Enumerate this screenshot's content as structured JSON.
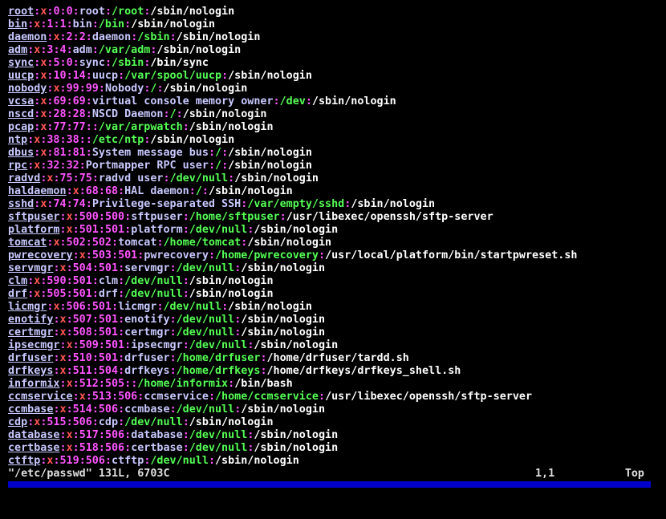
{
  "editor": {
    "lines": [
      {
        "user": "root",
        "pw": "x",
        "uid": "0",
        "gid": "0",
        "gecos": "root",
        "home": "/root",
        "shell": "/sbin/nologin"
      },
      {
        "user": "bin",
        "pw": "x",
        "uid": "1",
        "gid": "1",
        "gecos": "bin",
        "home": "/bin",
        "shell": "/sbin/nologin"
      },
      {
        "user": "daemon",
        "pw": "x",
        "uid": "2",
        "gid": "2",
        "gecos": "daemon",
        "home": "/sbin",
        "shell": "/sbin/nologin"
      },
      {
        "user": "adm",
        "pw": "x",
        "uid": "3",
        "gid": "4",
        "gecos": "adm",
        "home": "/var/adm",
        "shell": "/sbin/nologin"
      },
      {
        "user": "sync",
        "pw": "x",
        "uid": "5",
        "gid": "0",
        "gecos": "sync",
        "home": "/sbin",
        "shell": "/bin/sync"
      },
      {
        "user": "uucp",
        "pw": "x",
        "uid": "10",
        "gid": "14",
        "gecos": "uucp",
        "home": "/var/spool/uucp",
        "shell": "/sbin/nologin"
      },
      {
        "user": "nobody",
        "pw": "x",
        "uid": "99",
        "gid": "99",
        "gecos": "Nobody",
        "home": "/",
        "shell": "/sbin/nologin"
      },
      {
        "user": "vcsa",
        "pw": "x",
        "uid": "69",
        "gid": "69",
        "gecos": "virtual console memory owner",
        "home": "/dev",
        "shell": "/sbin/nologin"
      },
      {
        "user": "nscd",
        "pw": "x",
        "uid": "28",
        "gid": "28",
        "gecos": "NSCD Daemon",
        "home": "/",
        "shell": "/sbin/nologin"
      },
      {
        "user": "pcap",
        "pw": "x",
        "uid": "77",
        "gid": "77",
        "gecos": "",
        "home": "/var/arpwatch",
        "shell": "/sbin/nologin"
      },
      {
        "user": "ntp",
        "pw": "x",
        "uid": "38",
        "gid": "38",
        "gecos": "",
        "home": "/etc/ntp",
        "shell": "/sbin/nologin"
      },
      {
        "user": "dbus",
        "pw": "x",
        "uid": "81",
        "gid": "81",
        "gecos": "System message bus",
        "home": "/",
        "shell": "/sbin/nologin"
      },
      {
        "user": "rpc",
        "pw": "x",
        "uid": "32",
        "gid": "32",
        "gecos": "Portmapper RPC user",
        "home": "/",
        "shell": "/sbin/nologin"
      },
      {
        "user": "radvd",
        "pw": "x",
        "uid": "75",
        "gid": "75",
        "gecos": "radvd user",
        "home": "/dev/null",
        "shell": "/sbin/nologin"
      },
      {
        "user": "haldaemon",
        "pw": "x",
        "uid": "68",
        "gid": "68",
        "gecos": "HAL daemon",
        "home": "/",
        "shell": "/sbin/nologin"
      },
      {
        "user": "sshd",
        "pw": "x",
        "uid": "74",
        "gid": "74",
        "gecos": "Privilege-separated SSH",
        "home": "/var/empty/sshd",
        "shell": "/sbin/nologin"
      },
      {
        "user": "sftpuser",
        "pw": "x",
        "uid": "500",
        "gid": "500",
        "gecos": "sftpuser",
        "home": "/home/sftpuser",
        "shell": "/usr/libexec/openssh/sftp-server"
      },
      {
        "user": "platform",
        "pw": "x",
        "uid": "501",
        "gid": "501",
        "gecos": "platform",
        "home": "/dev/null",
        "shell": "/sbin/nologin"
      },
      {
        "user": "tomcat",
        "pw": "x",
        "uid": "502",
        "gid": "502",
        "gecos": "tomcat",
        "home": "/home/tomcat",
        "shell": "/sbin/nologin"
      },
      {
        "user": "pwrecovery",
        "pw": "x",
        "uid": "503",
        "gid": "501",
        "gecos": "pwrecovery",
        "home": "/home/pwrecovery",
        "shell": "/usr/local/platform/bin/startpwreset.sh"
      },
      {
        "user": "servmgr",
        "pw": "x",
        "uid": "504",
        "gid": "501",
        "gecos": "servmgr",
        "home": "/dev/null",
        "shell": "/sbin/nologin"
      },
      {
        "user": "clm",
        "pw": "x",
        "uid": "590",
        "gid": "501",
        "gecos": "clm",
        "home": "/dev/null",
        "shell": "/sbin/nologin"
      },
      {
        "user": "drf",
        "pw": "x",
        "uid": "505",
        "gid": "501",
        "gecos": "drf",
        "home": "/dev/null",
        "shell": "/sbin/nologin"
      },
      {
        "user": "licmgr",
        "pw": "x",
        "uid": "506",
        "gid": "501",
        "gecos": "licmgr",
        "home": "/dev/null",
        "shell": "/sbin/nologin"
      },
      {
        "user": "enotify",
        "pw": "x",
        "uid": "507",
        "gid": "501",
        "gecos": "enotify",
        "home": "/dev/null",
        "shell": "/sbin/nologin"
      },
      {
        "user": "certmgr",
        "pw": "x",
        "uid": "508",
        "gid": "501",
        "gecos": "certmgr",
        "home": "/dev/null",
        "shell": "/sbin/nologin"
      },
      {
        "user": "ipsecmgr",
        "pw": "x",
        "uid": "509",
        "gid": "501",
        "gecos": "ipsecmgr",
        "home": "/dev/null",
        "shell": "/sbin/nologin"
      },
      {
        "user": "drfuser",
        "pw": "x",
        "uid": "510",
        "gid": "501",
        "gecos": "drfuser",
        "home": "/home/drfuser",
        "shell": "/home/drfuser/tardd.sh"
      },
      {
        "user": "drfkeys",
        "pw": "x",
        "uid": "511",
        "gid": "504",
        "gecos": "drfkeys",
        "home": "/home/drfkeys",
        "shell": "/home/drfkeys/drfkeys_shell.sh"
      },
      {
        "user": "informix",
        "pw": "x",
        "uid": "512",
        "gid": "505",
        "gecos": "",
        "home": "/home/informix",
        "shell": "/bin/bash"
      },
      {
        "user": "ccmservice",
        "pw": "x",
        "uid": "513",
        "gid": "506",
        "gecos": "ccmservice",
        "home": "/home/ccmservice",
        "shell": "/usr/libexec/openssh/sftp-server"
      },
      {
        "user": "ccmbase",
        "pw": "x",
        "uid": "514",
        "gid": "506",
        "gecos": "ccmbase",
        "home": "/dev/null",
        "shell": "/sbin/nologin"
      },
      {
        "user": "cdp",
        "pw": "x",
        "uid": "515",
        "gid": "506",
        "gecos": "cdp",
        "home": "/dev/null",
        "shell": "/sbin/nologin"
      },
      {
        "user": "database",
        "pw": "x",
        "uid": "517",
        "gid": "506",
        "gecos": "database",
        "home": "/dev/null",
        "shell": "/sbin/nologin"
      },
      {
        "user": "certbase",
        "pw": "x",
        "uid": "518",
        "gid": "506",
        "gecos": "certbase",
        "home": "/dev/null",
        "shell": "/sbin/nologin"
      },
      {
        "user": "ctftp",
        "pw": "x",
        "uid": "519",
        "gid": "506",
        "gecos": "ctftp",
        "home": "/dev/null",
        "shell": "/sbin/nologin"
      }
    ]
  },
  "status": {
    "file": "\"/etc/passwd\" 131L, 6703C",
    "position": "1,1",
    "scroll": "Top"
  },
  "colors": {
    "background": "#000000",
    "username": "#c8c8ff",
    "separator": "#ff55ff",
    "password": "#ff5555",
    "ids": "#ff55ff",
    "home": "#55ff55",
    "shell": "#ffffff",
    "bottom_bar": "#0000c8"
  }
}
